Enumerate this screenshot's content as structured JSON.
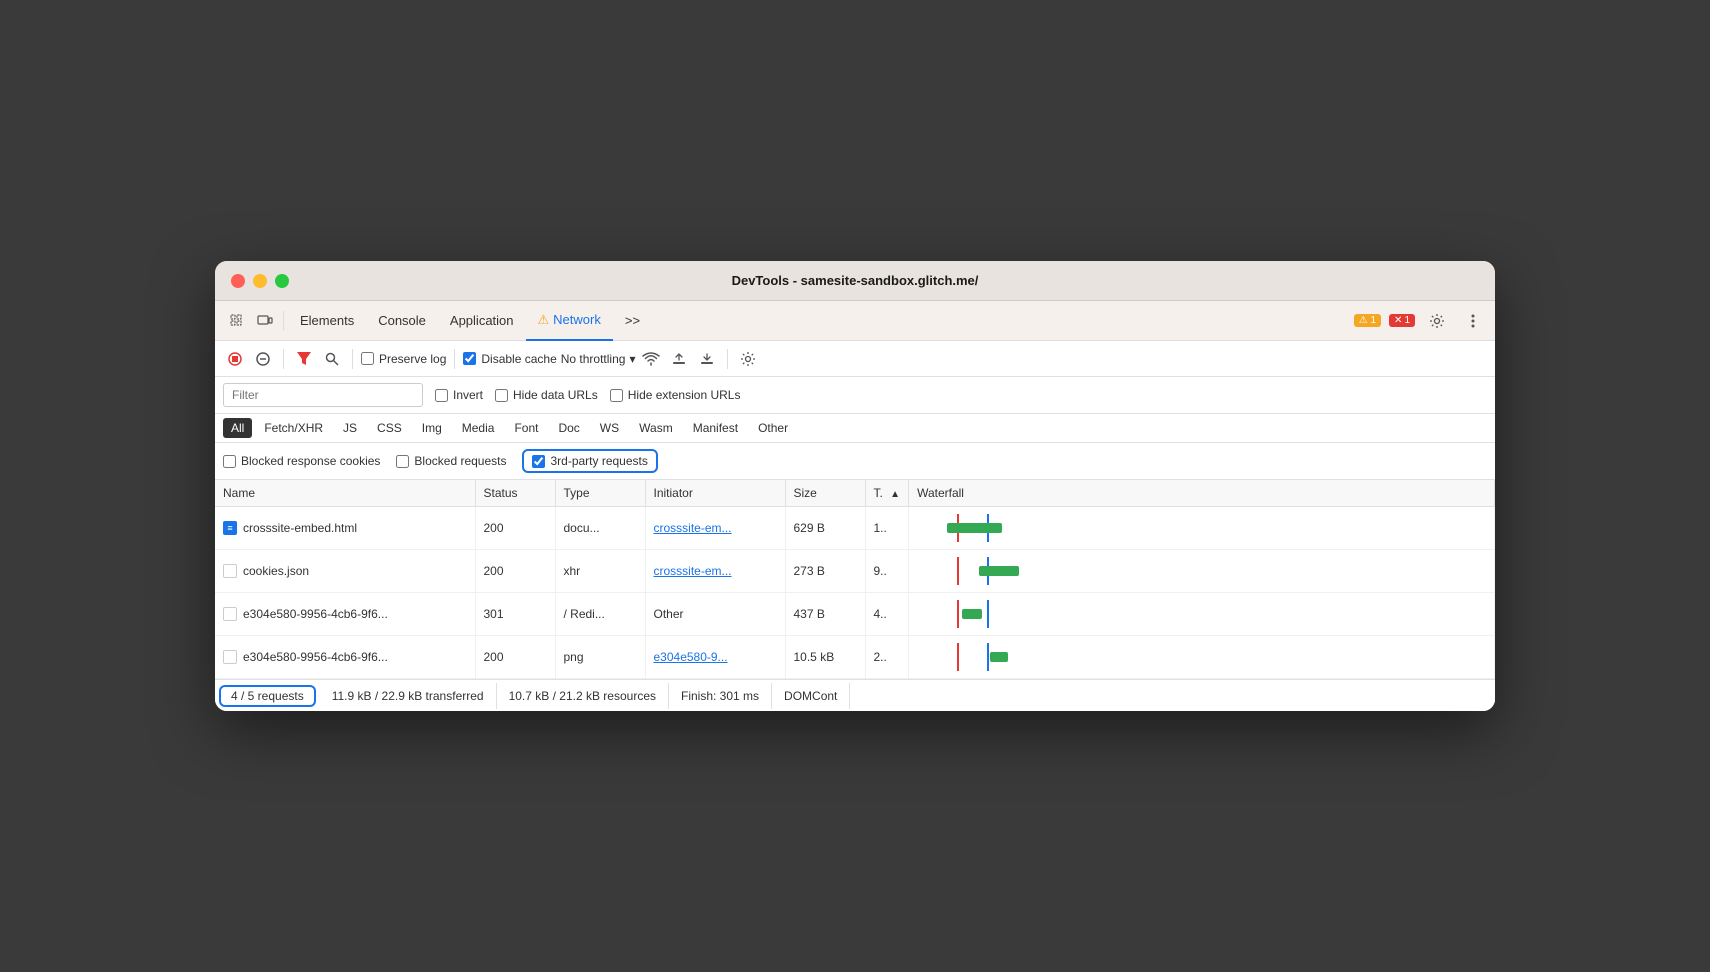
{
  "window": {
    "title": "DevTools - samesite-sandbox.glitch.me/"
  },
  "tabs": {
    "items": [
      {
        "label": "Elements",
        "active": false
      },
      {
        "label": "Console",
        "active": false
      },
      {
        "label": "Application",
        "active": false
      },
      {
        "label": "Network",
        "active": true
      },
      {
        "label": ">>",
        "active": false
      }
    ],
    "warning_badge": "⚠ 1",
    "error_badge": "✕ 1",
    "more_label": ">>"
  },
  "toolbar": {
    "preserve_log_label": "Preserve log",
    "disable_cache_label": "Disable cache",
    "throttle_label": "No throttling"
  },
  "filter": {
    "placeholder": "Filter",
    "invert_label": "Invert",
    "hide_data_urls_label": "Hide data URLs",
    "hide_extension_urls_label": "Hide extension URLs"
  },
  "type_filters": [
    "All",
    "Fetch/XHR",
    "JS",
    "CSS",
    "Img",
    "Media",
    "Font",
    "Doc",
    "WS",
    "Wasm",
    "Manifest",
    "Other"
  ],
  "blocked_filters": {
    "blocked_response_cookies_label": "Blocked response cookies",
    "blocked_requests_label": "Blocked requests",
    "third_party_requests_label": "3rd-party requests",
    "third_party_checked": true
  },
  "table": {
    "headers": [
      "Name",
      "Status",
      "Type",
      "Initiator",
      "Size",
      "T.",
      "Waterfall"
    ],
    "rows": [
      {
        "name": "crosssite-embed.html",
        "status": "200",
        "type": "docu...",
        "initiator": "crosssite-em...",
        "initiator_link": true,
        "size": "629 B",
        "time": "1..",
        "icon": "doc"
      },
      {
        "name": "cookies.json",
        "status": "200",
        "type": "xhr",
        "initiator": "crosssite-em...",
        "initiator_link": true,
        "size": "273 B",
        "time": "9..",
        "icon": "blank"
      },
      {
        "name": "e304e580-9956-4cb6-9f6...",
        "status": "301",
        "type": "/ Redi...",
        "initiator": "Other",
        "initiator_link": false,
        "size": "437 B",
        "time": "4..",
        "icon": "blank"
      },
      {
        "name": "e304e580-9956-4cb6-9f6...",
        "status": "200",
        "type": "png",
        "initiator": "e304e580-9...",
        "initiator_link": true,
        "size": "10.5 kB",
        "time": "2..",
        "icon": "blank"
      }
    ]
  },
  "status_bar": {
    "requests": "4 / 5 requests",
    "transferred": "11.9 kB / 22.9 kB transferred",
    "resources": "10.7 kB / 21.2 kB resources",
    "finish": "Finish: 301 ms",
    "domcont": "DOMCont"
  },
  "colors": {
    "accent": "#1a73e8",
    "warning": "#f5a623",
    "error": "#e53935",
    "active_tab_underline": "#1a73e8"
  }
}
